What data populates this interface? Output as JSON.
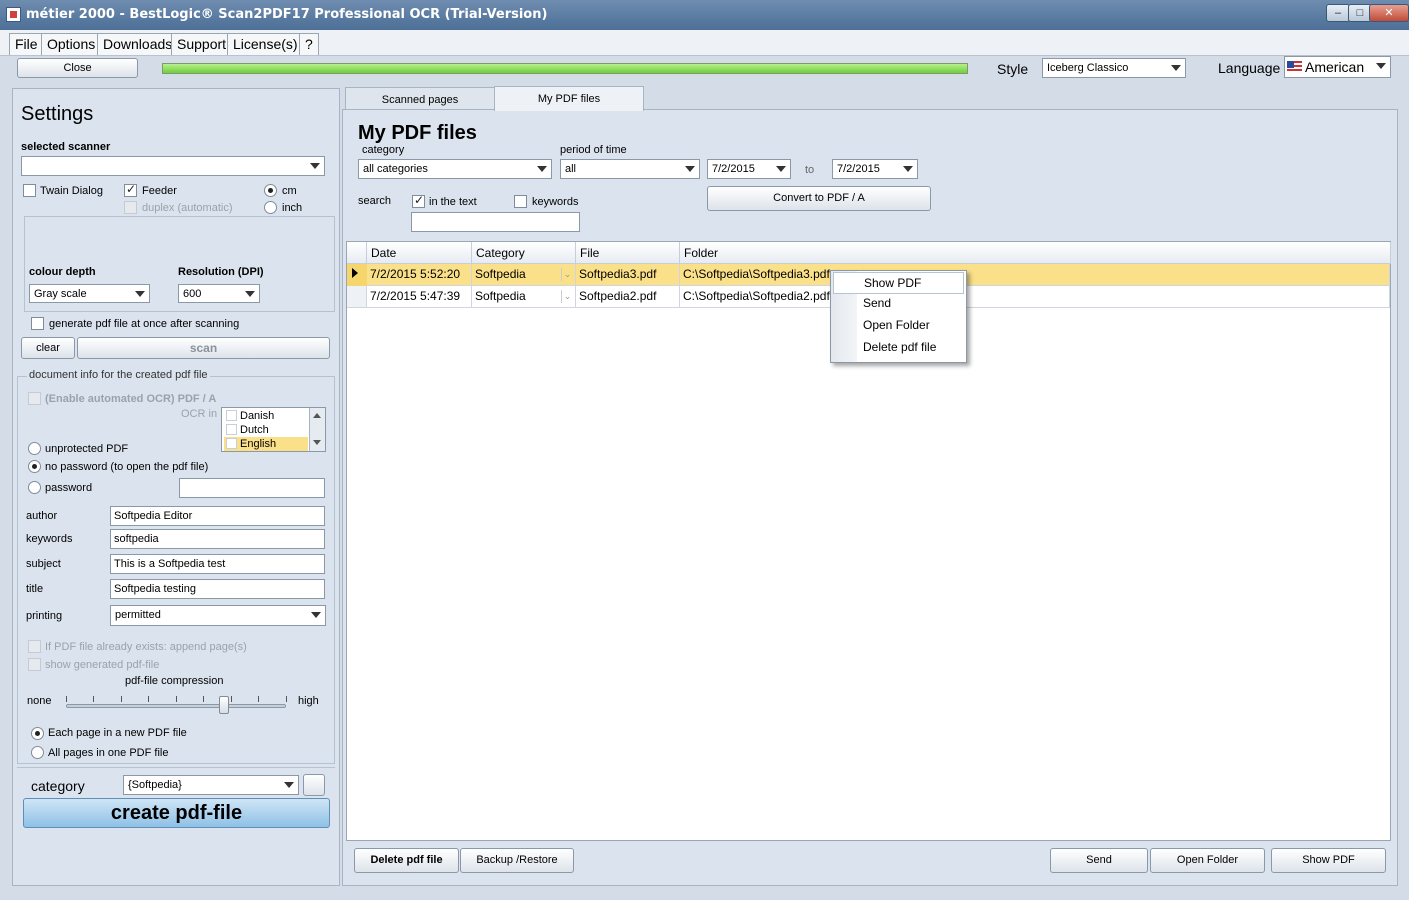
{
  "window": {
    "title": "métier 2000 - BestLogic® Scan2PDF17 Professional OCR (Trial-Version)",
    "min": "–",
    "max": "□",
    "close": "✕"
  },
  "menu": [
    "File",
    "Options",
    "Downloads",
    "Support",
    "License(s)",
    "?"
  ],
  "toolbar": {
    "close_label": "Close",
    "progress": 1.0,
    "style_label": "Style",
    "style_value": "Iceberg Classico",
    "language_label": "Language",
    "language_value": "American"
  },
  "settings": {
    "heading": "Settings",
    "scanner_label": "selected scanner",
    "scanner_value": "",
    "twain_label": "Twain Dialog",
    "feeder_label": "Feeder",
    "duplex_label": "duplex (automatic)",
    "cm_label": "cm",
    "inch_label": "inch",
    "colour_depth_label": "colour depth",
    "colour_depth_value": "Gray scale",
    "resolution_label": "Resolution (DPI)",
    "resolution_value": "600",
    "generate_label": "generate pdf file at once after scanning",
    "clear_label": "clear",
    "scan_label": "scan",
    "docinfo_legend": "document info for the created pdf file",
    "ocr_enable_label": "(Enable automated OCR) PDF / A",
    "ocr_in_label": "OCR in",
    "ocr_langs": [
      "Danish",
      "Dutch",
      "English"
    ],
    "unprotected_label": "unprotected PDF",
    "nopassword_label": "no password (to open the pdf file)",
    "password_label": "password",
    "password_value": "",
    "author_label": "author",
    "author_value": "Softpedia Editor",
    "keywords_label": "keywords",
    "keywords_value": "softpedia",
    "subject_label": "subject",
    "subject_value": "This is a Softpedia test",
    "title_label": "title",
    "title_value": "Softpedia testing",
    "printing_label": "printing",
    "printing_value": "permitted",
    "append_label": "If PDF file already exists: append page(s)",
    "showgen_label": "show generated pdf-file",
    "compression_label": "pdf-file compression",
    "none_label": "none",
    "high_label": "high",
    "compression_level": 0.72,
    "each_page_label": "Each page in a new PDF file",
    "all_pages_label": "All pages in one PDF file",
    "category_label": "category",
    "category_value": "{Softpedia}",
    "create_label": "create pdf-file"
  },
  "tabs": {
    "scanned": "Scanned pages",
    "mypdf": "My PDF files"
  },
  "mypdf": {
    "heading": "My PDF files",
    "category_label": "category",
    "category_value": "all categories",
    "period_label": "period of time",
    "period_value": "all",
    "date_from": "7/2/2015",
    "to_label": "to",
    "date_to": "7/2/2015",
    "search_label": "search",
    "in_text_label": "in the text",
    "keywords_label": "keywords",
    "search_value": "",
    "convert_label": "Convert to PDF / A",
    "columns": [
      "Date",
      "Category",
      "File",
      "Folder"
    ],
    "rows": [
      {
        "date": "7/2/2015 5:52:20",
        "category": "Softpedia",
        "file": "Softpedia3.pdf",
        "folder": "C:\\Softpedia\\Softpedia3.pdf"
      },
      {
        "date": "7/2/2015 5:47:39",
        "category": "Softpedia",
        "file": "Softpedia2.pdf",
        "folder": "C:\\Softpedia\\Softpedia2.pdf"
      }
    ],
    "context_menu": [
      "Show PDF",
      "Send",
      "Open Folder",
      "Delete pdf file"
    ],
    "delete_label": "Delete pdf file",
    "backup_label": "Backup /Restore",
    "send_label": "Send",
    "open_folder_label": "Open Folder",
    "show_pdf_label": "Show PDF"
  }
}
